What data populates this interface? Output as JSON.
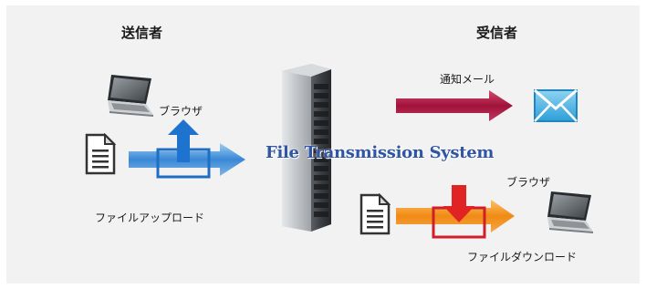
{
  "sender": {
    "title": "送信者",
    "browser_label": "ブラウザ",
    "upload_label": "ファイルアップロード"
  },
  "receiver": {
    "title": "受信者",
    "notification_label": "通知メール",
    "browser_label": "ブラウザ",
    "download_label": "ファイルダウンロード"
  },
  "system": {
    "title": "File Transmission System"
  },
  "colors": {
    "background": "#f2f2f2",
    "system_title": "#2f55a4",
    "upload_arrow": "#3a87d6",
    "notify_arrow": "#a1123b",
    "download_arrow": "#f08a14",
    "upload_icon": "#1e73cf",
    "download_icon": "#e02424",
    "mail_icon": "#45b6e6"
  },
  "icons": {
    "sender_computer": "laptop-icon",
    "sender_file": "document-icon",
    "upload": "upload-tray-icon",
    "server": "server-rack-icon",
    "mail": "envelope-icon",
    "receiver_file": "document-icon",
    "download": "download-tray-icon",
    "receiver_computer": "laptop-icon"
  }
}
